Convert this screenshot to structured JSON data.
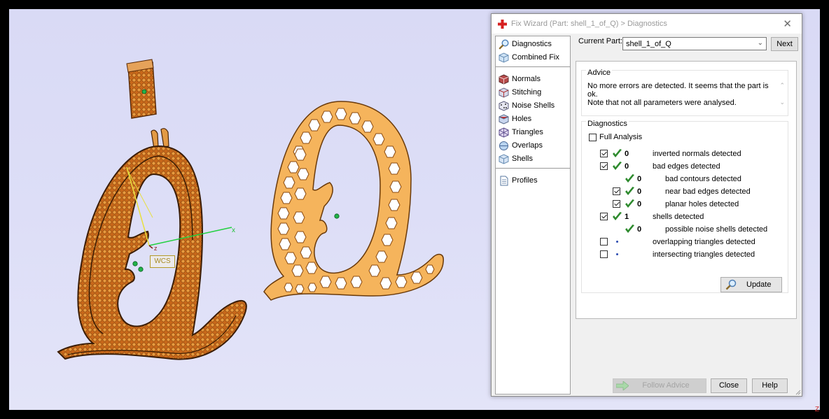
{
  "viewport": {
    "wcs_label": "WCS",
    "axis_x_label": "x",
    "axis_z_label": "z",
    "corner_axis_label": "Z"
  },
  "dialog": {
    "title": "Fix Wizard (Part: shell_1_of_Q) > Diagnostics",
    "close_glyph": "✕",
    "nav": {
      "top": [
        {
          "label": "Diagnostics",
          "icon": "magnifier-icon",
          "selected": true
        },
        {
          "label": "Combined Fix",
          "icon": "cube-icon",
          "selected": false
        }
      ],
      "tools": [
        {
          "label": "Normals",
          "icon": "normals-cube-icon"
        },
        {
          "label": "Stitching",
          "icon": "stitching-cube-icon"
        },
        {
          "label": "Noise Shells",
          "icon": "noise-shells-icon"
        },
        {
          "label": "Holes",
          "icon": "holes-cube-icon"
        },
        {
          "label": "Triangles",
          "icon": "triangles-icon"
        },
        {
          "label": "Overlaps",
          "icon": "overlaps-icon"
        },
        {
          "label": "Shells",
          "icon": "shells-cube-icon"
        }
      ],
      "bottom": [
        {
          "label": "Profiles",
          "icon": "document-icon"
        }
      ]
    },
    "current_part": {
      "label": "Current Part:",
      "value": "shell_1_of_Q",
      "next_label": "Next"
    },
    "advice": {
      "title": "Advice",
      "line1": "No more errors are detected. It seems that the part is ok.",
      "line2": "Note that not all parameters were analysed."
    },
    "diagnostics": {
      "title": "Diagnostics",
      "full_analysis_label": "Full Analysis",
      "full_analysis_checked": false,
      "rows": [
        {
          "checkbox": true,
          "checked": true,
          "status": "ok",
          "count": "0",
          "label": "inverted normals detected",
          "indent": 0
        },
        {
          "checkbox": true,
          "checked": true,
          "status": "ok",
          "count": "0",
          "label": "bad edges detected",
          "indent": 0
        },
        {
          "checkbox": false,
          "checked": false,
          "status": "ok",
          "count": "0",
          "label": "bad contours detected",
          "indent": 1
        },
        {
          "checkbox": true,
          "checked": true,
          "status": "ok",
          "count": "0",
          "label": "near bad edges detected",
          "indent": 1
        },
        {
          "checkbox": true,
          "checked": true,
          "status": "ok",
          "count": "0",
          "label": "planar holes detected",
          "indent": 1
        },
        {
          "checkbox": true,
          "checked": true,
          "status": "ok",
          "count": "1",
          "label": "shells detected",
          "indent": 0
        },
        {
          "checkbox": false,
          "checked": false,
          "status": "ok",
          "count": "0",
          "label": "possible noise shells detected",
          "indent": 1
        },
        {
          "checkbox": true,
          "checked": false,
          "status": "none",
          "count": "",
          "label": "overlapping triangles detected",
          "indent": 0
        },
        {
          "checkbox": true,
          "checked": false,
          "status": "none",
          "count": "",
          "label": "intersecting triangles detected",
          "indent": 0
        }
      ],
      "update_label": "Update"
    },
    "buttons": {
      "follow_advice": "Follow Advice",
      "close": "Close",
      "help": "Help"
    },
    "colors": {
      "accent_check": "#2d8a2d",
      "app_icon": "#d62020",
      "part_orange": "#e4922f",
      "part_light_orange": "#f5b45c"
    }
  }
}
